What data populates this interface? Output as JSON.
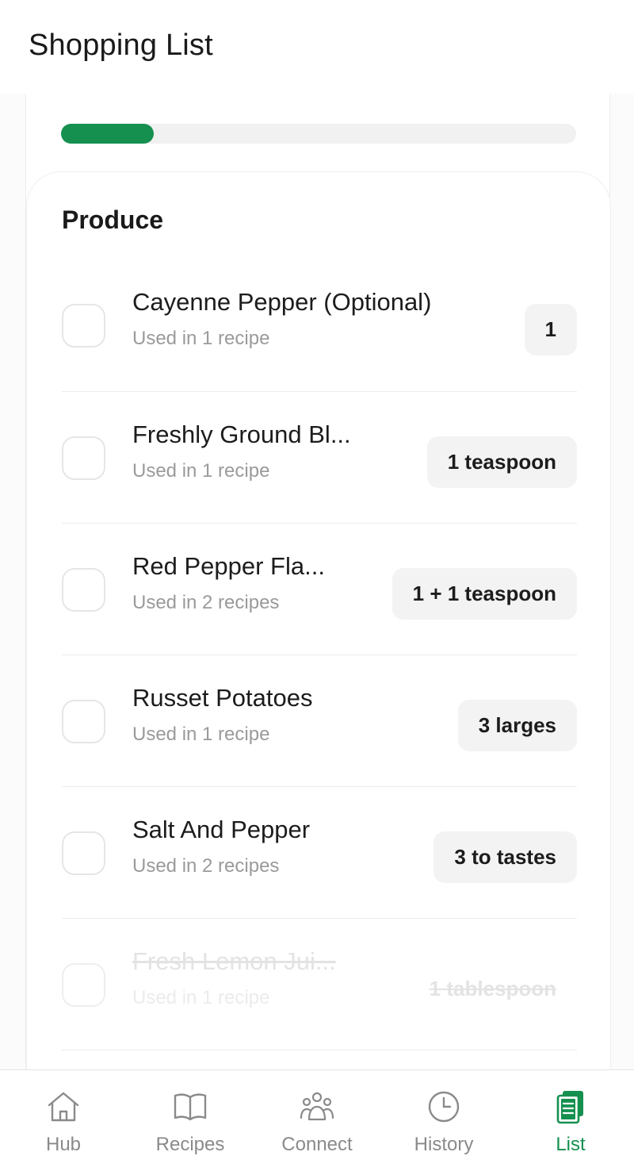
{
  "header": {
    "title": "Shopping List"
  },
  "progress": {
    "fraction": 0.18,
    "color": "#15904f"
  },
  "section": {
    "title": "Produce",
    "items": [
      {
        "name": "Cayenne Pepper (Optional)",
        "usage": "Used in 1 recipe",
        "quantity": "1",
        "checked": false
      },
      {
        "name": "Freshly Ground Bl...",
        "usage": "Used in 1 recipe",
        "quantity": "1 teaspoon",
        "checked": false
      },
      {
        "name": "Red Pepper Fla...",
        "usage": "Used in 2 recipes",
        "quantity": "1 + 1 teaspoon",
        "checked": false
      },
      {
        "name": "Russet Potatoes",
        "usage": "Used in 1 recipe",
        "quantity": "3 larges",
        "checked": false
      },
      {
        "name": "Salt And Pepper",
        "usage": "Used in 2 recipes",
        "quantity": "3 to tastes",
        "checked": false
      },
      {
        "name": "Fresh Lemon Jui...",
        "usage": "Used in 1 recipe",
        "quantity": "1 tablespoon",
        "checked": false,
        "struck_through": true
      }
    ]
  },
  "nav": {
    "items": [
      {
        "label": "Hub",
        "icon": "home-icon",
        "active": false
      },
      {
        "label": "Recipes",
        "icon": "book-icon",
        "active": false
      },
      {
        "label": "Connect",
        "icon": "people-icon",
        "active": false
      },
      {
        "label": "History",
        "icon": "clock-icon",
        "active": false
      },
      {
        "label": "List",
        "icon": "list-icon",
        "active": true
      }
    ],
    "active_color": "#15904f",
    "inactive_color": "#8a8a8a"
  }
}
